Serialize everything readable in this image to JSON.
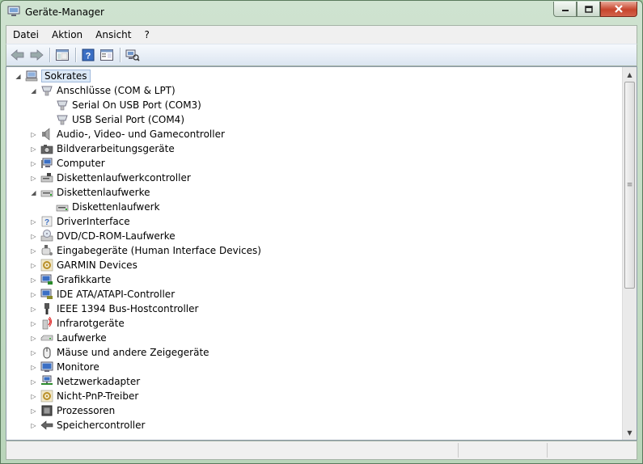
{
  "window": {
    "title": "Geräte-Manager"
  },
  "menu": [
    "Datei",
    "Aktion",
    "Ansicht",
    "?"
  ],
  "toolbar": {
    "buttons": [
      "back-icon",
      "forward-icon",
      "console-tree-icon",
      "help-icon",
      "properties-icon",
      "scan-hardware-icon"
    ]
  },
  "tree": {
    "root": "Sokrates",
    "items": [
      {
        "label": "Anschlüsse (COM & LPT)",
        "level": 1,
        "expanded": true,
        "icon": "port-icon"
      },
      {
        "label": "Serial On USB Port (COM3)",
        "level": 2,
        "leaf": true,
        "icon": "port-icon"
      },
      {
        "label": "USB Serial Port (COM4)",
        "level": 2,
        "leaf": true,
        "icon": "port-icon"
      },
      {
        "label": "Audio-, Video- und Gamecontroller",
        "level": 1,
        "icon": "speaker-icon"
      },
      {
        "label": "Bildverarbeitungsgeräte",
        "level": 1,
        "icon": "camera-icon"
      },
      {
        "label": "Computer",
        "level": 1,
        "icon": "computer-icon"
      },
      {
        "label": "Diskettenlaufwerkcontroller",
        "level": 1,
        "icon": "floppy-controller-icon"
      },
      {
        "label": "Diskettenlaufwerke",
        "level": 1,
        "expanded": true,
        "icon": "floppy-drive-icon"
      },
      {
        "label": "Diskettenlaufwerk",
        "level": 2,
        "leaf": true,
        "icon": "floppy-drive-icon"
      },
      {
        "label": "DriverInterface",
        "level": 1,
        "icon": "unknown-device-icon"
      },
      {
        "label": "DVD/CD-ROM-Laufwerke",
        "level": 1,
        "icon": "dvd-icon"
      },
      {
        "label": "Eingabegeräte (Human Interface Devices)",
        "level": 1,
        "icon": "hid-icon"
      },
      {
        "label": "GARMIN Devices",
        "level": 1,
        "icon": "gear-device-icon"
      },
      {
        "label": "Grafikkarte",
        "level": 1,
        "icon": "display-adapter-icon"
      },
      {
        "label": "IDE ATA/ATAPI-Controller",
        "level": 1,
        "icon": "ide-controller-icon"
      },
      {
        "label": "IEEE 1394 Bus-Hostcontroller",
        "level": 1,
        "icon": "firewire-icon"
      },
      {
        "label": "Infrarotgeräte",
        "level": 1,
        "icon": "infrared-icon"
      },
      {
        "label": "Laufwerke",
        "level": 1,
        "icon": "disk-drive-icon"
      },
      {
        "label": "Mäuse und andere Zeigegeräte",
        "level": 1,
        "icon": "mouse-icon"
      },
      {
        "label": "Monitore",
        "level": 1,
        "icon": "monitor-icon"
      },
      {
        "label": "Netzwerkadapter",
        "level": 1,
        "icon": "network-adapter-icon"
      },
      {
        "label": "Nicht-PnP-Treiber",
        "level": 1,
        "icon": "gear-device-icon"
      },
      {
        "label": "Prozessoren",
        "level": 1,
        "icon": "processor-icon"
      },
      {
        "label": "Speichercontroller",
        "level": 1,
        "icon": "storage-controller-icon"
      }
    ]
  }
}
